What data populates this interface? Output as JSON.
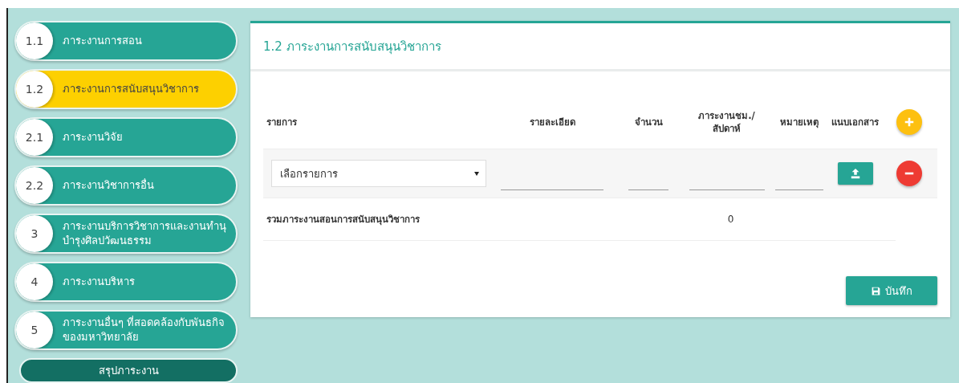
{
  "sidebar": {
    "items": [
      {
        "number": "1.1",
        "label": "ภาระงานการสอน",
        "selected": false
      },
      {
        "number": "1.2",
        "label": "ภาระงานการสนับสนุนวิชาการ",
        "selected": true
      },
      {
        "number": "2.1",
        "label": "ภาระงานวิจัย",
        "selected": false
      },
      {
        "number": "2.2",
        "label": "ภาระงานวิชาการอื่น",
        "selected": false
      },
      {
        "number": "3",
        "label": "ภาระงานบริการวิชาการและงานทำนุบำรุงศิลปวัฒนธรรม",
        "selected": false
      },
      {
        "number": "4",
        "label": "ภาระงานบริหาร",
        "selected": false
      },
      {
        "number": "5",
        "label": "ภาระงานอื่นๆ ที่สอดคล้องกับพันธกิจของมหาวิทยาลัย",
        "selected": false
      }
    ],
    "summary_button": "สรุปภาระงาน"
  },
  "panel": {
    "title": "1.2 ภาระงานการสนับสนุนวิชาการ",
    "table": {
      "columns": [
        "รายการ",
        "รายละเอียด",
        "จำนวน",
        "ภาระงานชม./สัปดาห์",
        "หมายเหตุ",
        "แนบเอกสาร"
      ],
      "rows": [
        {
          "item_select": "เลือกรายการ"
        }
      ],
      "total": {
        "label": "รวมภาระงานสอนการสนับสนุนวิชาการ",
        "value": "0"
      }
    },
    "save_button": "บันทึก"
  }
}
